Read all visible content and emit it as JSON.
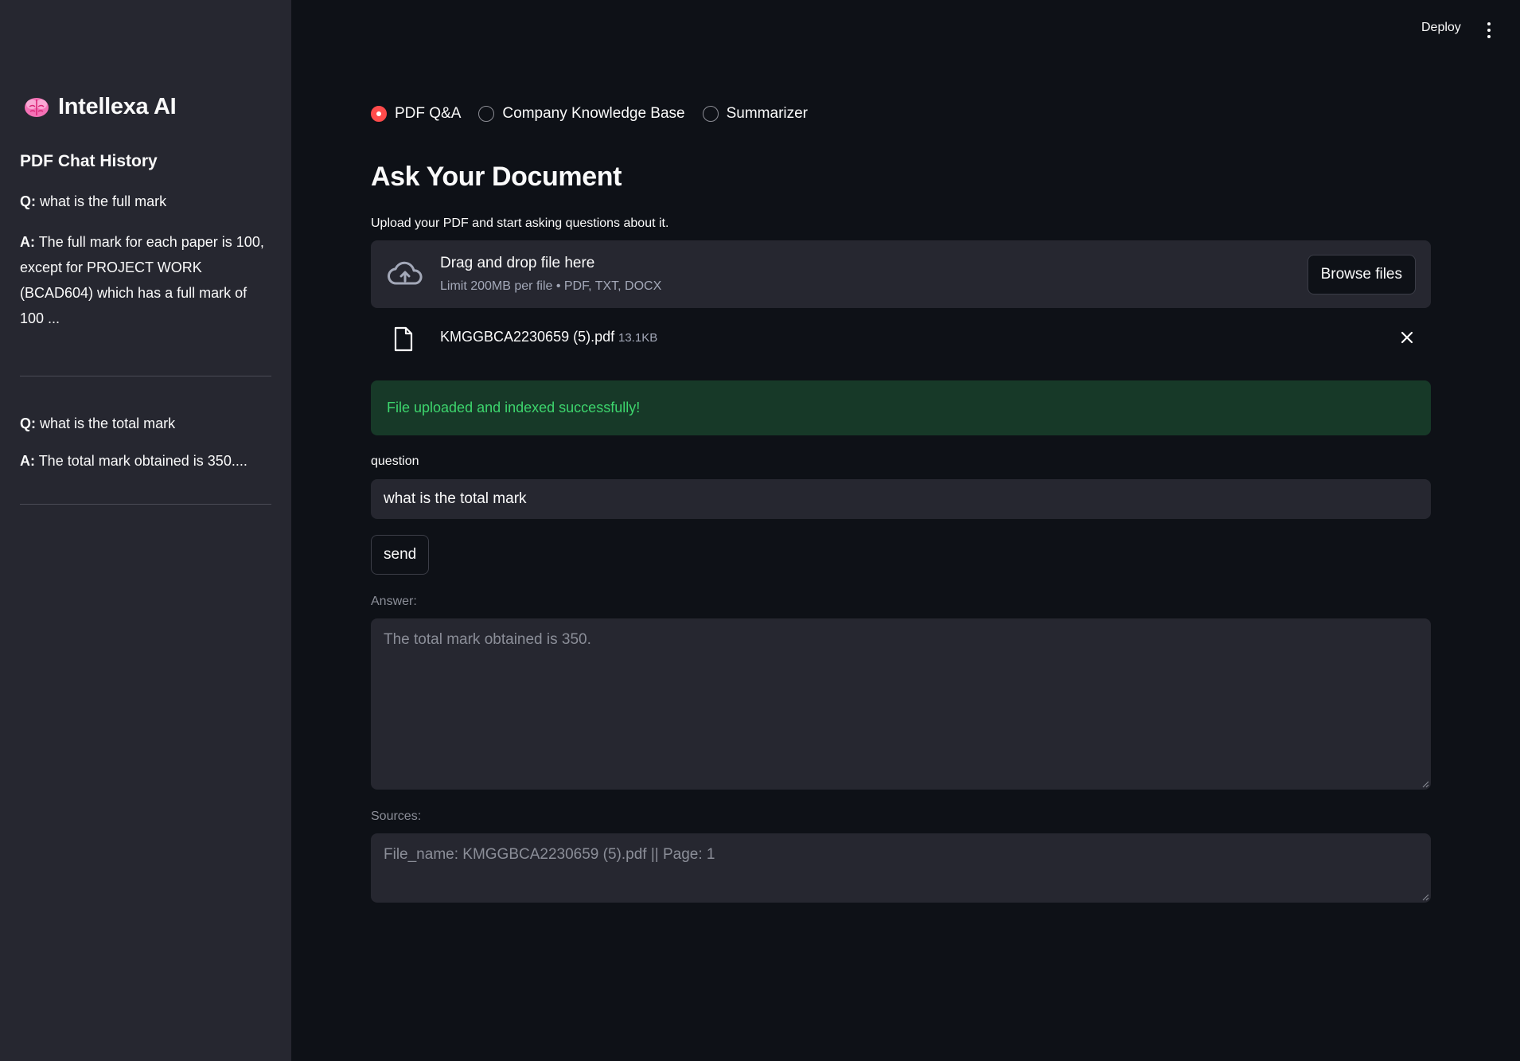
{
  "sidebar": {
    "brand": {
      "title": "Intellexa AI",
      "icon": "brain-icon"
    },
    "history_title": "PDF Chat History",
    "history": [
      {
        "q_label": "Q:",
        "question": "what is the full mark",
        "a_label": "A:",
        "answer": "The full mark for each paper is 100, except for PROJECT WORK (BCAD604) which has a full mark of 100 ..."
      },
      {
        "q_label": "Q:",
        "question": "what is the total mark",
        "a_label": "A:",
        "answer": "The total mark obtained is 350...."
      }
    ]
  },
  "header": {
    "deploy_label": "Deploy",
    "menu_icon": "more-vertical-icon"
  },
  "main": {
    "mode_options": [
      {
        "label": "PDF Q&A",
        "selected": true
      },
      {
        "label": "Company Knowledge Base",
        "selected": false
      },
      {
        "label": "Summarizer",
        "selected": false
      }
    ],
    "title": "Ask Your Document",
    "upload_label": "Upload your PDF and start asking questions about it.",
    "dropzone": {
      "icon": "cloud-upload-icon",
      "title": "Drag and drop file here",
      "subtitle": "Limit 200MB per file • PDF, TXT, DOCX",
      "browse_label": "Browse files"
    },
    "uploaded_file": {
      "icon": "file-icon",
      "name": "KMGGBCA2230659 (5).pdf",
      "size": "13.1KB",
      "remove_icon": "close-icon"
    },
    "success_message": "File uploaded and indexed successfully!",
    "question_label": "question",
    "question_value": "what is the total mark",
    "send_label": "send",
    "answer_label": "Answer:",
    "answer_value": "The total mark obtained is 350.",
    "sources_label": "Sources:",
    "sources_value": "File_name: KMGGBCA2230659 (5).pdf || Page: 1"
  },
  "colors": {
    "background": "#0e1117",
    "sidebar": "#262730",
    "accent": "#ff4b4b",
    "success_bg": "#173928",
    "success_text": "#3dd56d"
  }
}
